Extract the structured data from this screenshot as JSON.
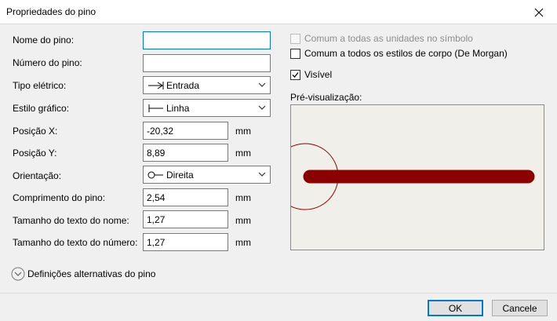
{
  "window": {
    "title": "Propriedades do pino",
    "close_icon": "close-icon"
  },
  "form": {
    "pin_name": {
      "label": "Nome do pino:",
      "value": ""
    },
    "pin_number": {
      "label": "Número do pino:",
      "value": ""
    },
    "electrical_type": {
      "label": "Tipo elétrico:",
      "value": "Entrada",
      "icon": "input-pin-icon"
    },
    "graphic_style": {
      "label": "Estilo gráfico:",
      "value": "Linha",
      "icon": "line-style-icon"
    },
    "pos_x": {
      "label": "Posição X:",
      "value": "-20,32",
      "unit": "mm"
    },
    "pos_y": {
      "label": "Posição Y:",
      "value": "8,89",
      "unit": "mm"
    },
    "orientation": {
      "label": "Orientação:",
      "value": "Direita",
      "icon": "orientation-right-icon"
    },
    "pin_length": {
      "label": "Comprimento do pino:",
      "value": "2,54",
      "unit": "mm"
    },
    "name_text_size": {
      "label": "Tamanho do texto do nome:",
      "value": "1,27",
      "unit": "mm"
    },
    "number_text_size": {
      "label": "Tamanho do texto do número:",
      "value": "1,27",
      "unit": "mm"
    }
  },
  "options": {
    "common_units": {
      "label": "Comum a todas as unidades no símbolo",
      "checked": false,
      "disabled": true
    },
    "common_styles": {
      "label": "Comum a todos os estilos de corpo (De Morgan)",
      "checked": false,
      "disabled": false
    },
    "visible": {
      "label": "Visível",
      "checked": true,
      "disabled": false
    }
  },
  "preview": {
    "label": "Pré-visualização:",
    "pin_color": "#8b0000",
    "background": "#f1efe9"
  },
  "alternates": {
    "label": "Definições alternativas do pino"
  },
  "buttons": {
    "ok": "OK",
    "cancel": "Cancele"
  },
  "colors": {
    "accent": "#0078d7"
  }
}
